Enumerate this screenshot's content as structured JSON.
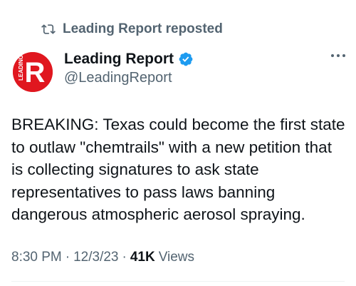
{
  "repost": {
    "icon": "repost-icon",
    "text": "Leading Report reposted"
  },
  "author": {
    "avatar_letter": "R",
    "avatar_text": "LEADING",
    "avatar_color": "#e0171f",
    "name": "Leading Report",
    "verified_icon": "verified-badge-icon",
    "verified_color": "#1d9bf0",
    "handle": "@LeadingReport"
  },
  "more_icon": "more-horizontal-icon",
  "tweet": {
    "text": "BREAKING: Texas could become the first state to outlaw \"chemtrails\" with a new petition that is collecting signatures to ask state representatives to pass laws banning dangerous atmospheric aerosol spraying."
  },
  "meta": {
    "time": "8:30 PM",
    "separator": "·",
    "date": "12/3/23",
    "views_count": "41K",
    "views_label": "Views"
  },
  "colors": {
    "text_primary": "#0f1419",
    "text_secondary": "#536471",
    "divider": "#eff3f4"
  }
}
